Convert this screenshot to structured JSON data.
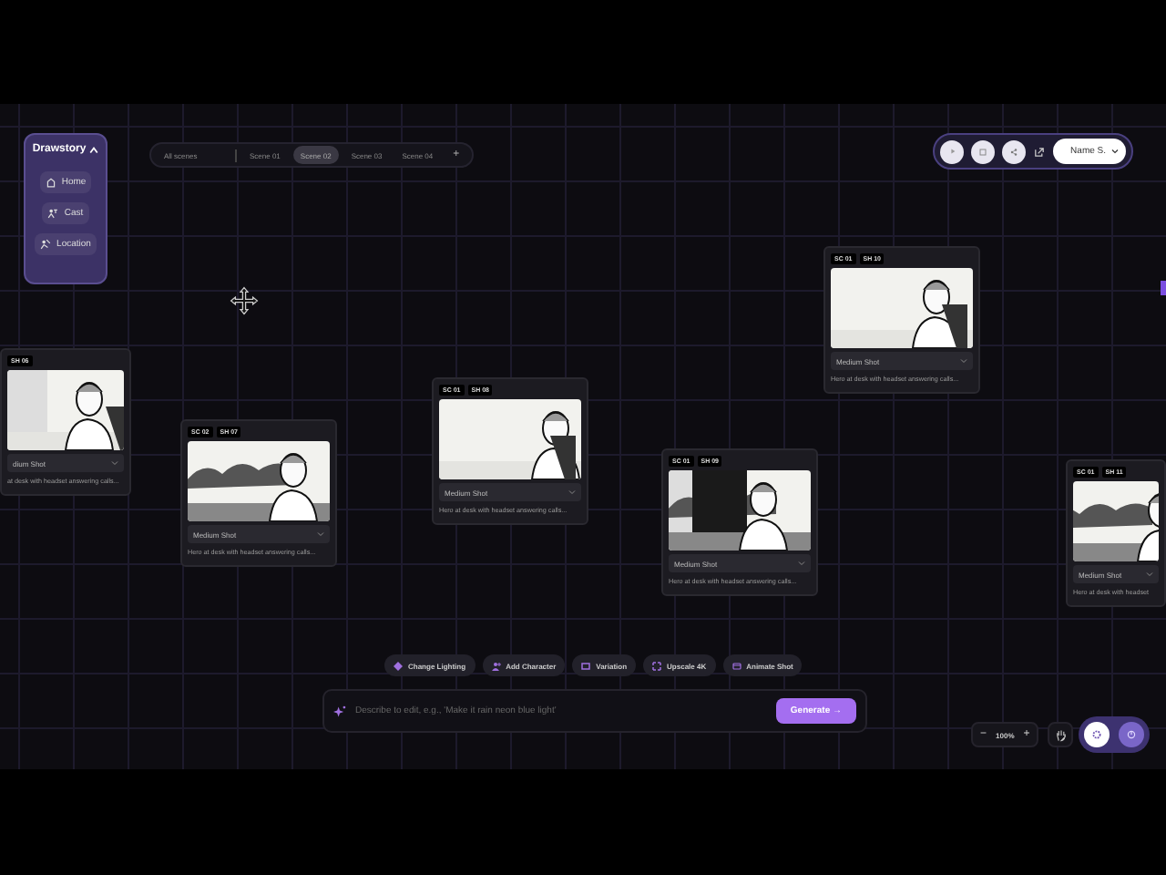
{
  "sidebar": {
    "title": "Drawstory",
    "items": [
      {
        "label": "Home",
        "kind": "home"
      },
      {
        "label": "Cast",
        "kind": "cast"
      },
      {
        "label": "Location",
        "kind": "location"
      }
    ]
  },
  "scene_tabs": {
    "all": "All scenes",
    "tabs": [
      {
        "label": "Scene 01",
        "selected": false
      },
      {
        "label": "Scene 02",
        "selected": true
      },
      {
        "label": "Scene 03",
        "selected": false
      },
      {
        "label": "Scene 04",
        "selected": false
      }
    ],
    "add": "+"
  },
  "user": {
    "name": "Name S."
  },
  "cards": [
    {
      "badges": [
        "SH 06"
      ],
      "shot": "dium Shot",
      "description": "at desk with headset answering calls..."
    },
    {
      "badges": [
        "SC 02",
        "SH 07"
      ],
      "shot": "Medium Shot",
      "description": "Hero at desk with headset answering calls..."
    },
    {
      "badges": [
        "SC 01",
        "SH 08"
      ],
      "shot": "Medium Shot",
      "description": "Hero at desk with headset answering calls..."
    },
    {
      "badges": [
        "SC 01",
        "SH 09"
      ],
      "shot": "Medium Shot",
      "description": "Hero at desk with headset answering calls..."
    },
    {
      "badges": [
        "SC 01",
        "SH 10"
      ],
      "shot": "Medium Shot",
      "description": "Hero at desk with headset answering calls..."
    },
    {
      "badges": [
        "SC 01",
        "SH 11"
      ],
      "shot": "Medium Shot",
      "description": "Hero at desk with headset"
    }
  ],
  "actions": [
    {
      "label": "Change Lighting",
      "kind": "light"
    },
    {
      "label": "Add Character",
      "kind": "character"
    },
    {
      "label": "Variation",
      "kind": "variation"
    },
    {
      "label": "Upscale 4K",
      "kind": "upscale"
    },
    {
      "label": "Animate Shot",
      "kind": "animate"
    }
  ],
  "prompt": {
    "placeholder": "Describe to edit, e.g., 'Make it rain neon blue light'",
    "button": "Generate →"
  },
  "zoom": {
    "minus": "−",
    "value": "100%",
    "plus": "+"
  },
  "modes": [
    {
      "kind": "settings",
      "selected": true
    },
    {
      "kind": "power",
      "selected": false
    }
  ]
}
